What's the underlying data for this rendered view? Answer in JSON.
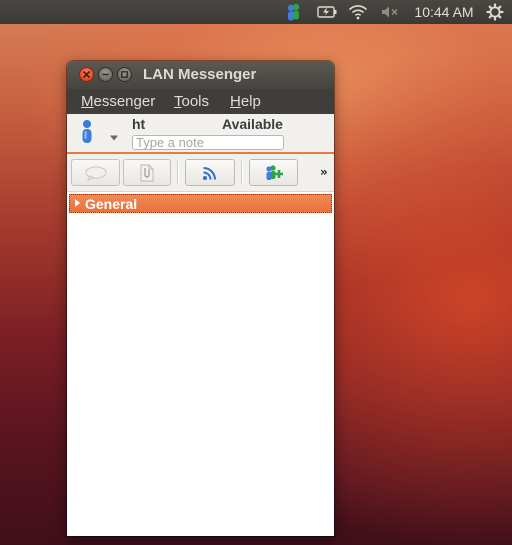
{
  "panel": {
    "icons": [
      "lan-messenger-tray-icon",
      "battery-icon",
      "wifi-icon",
      "volume-muted-icon",
      "settings-gear-icon"
    ],
    "clock": "10:44 AM"
  },
  "window": {
    "title": "LAN Messenger",
    "controls": [
      "close-icon",
      "minimize-icon",
      "maximize-icon"
    ]
  },
  "menu": {
    "items": [
      {
        "mnemonic": "M",
        "rest": "essenger"
      },
      {
        "mnemonic": "T",
        "rest": "ools"
      },
      {
        "mnemonic": "H",
        "rest": "elp"
      }
    ]
  },
  "user": {
    "name": "ht",
    "status": "Available",
    "note_placeholder": "Type a note",
    "note_value": ""
  },
  "toolbar": {
    "buttons": [
      "chat-icon",
      "file-transfer-icon",
      "broadcast-icon",
      "add-contact-icon"
    ],
    "overflow": "»"
  },
  "contacts": {
    "groups": [
      {
        "name": "General",
        "expanded": false
      }
    ]
  },
  "colors": {
    "accent": "#e8713d",
    "panel_bg": "#3c3b37",
    "close_button": "#e2542a"
  }
}
